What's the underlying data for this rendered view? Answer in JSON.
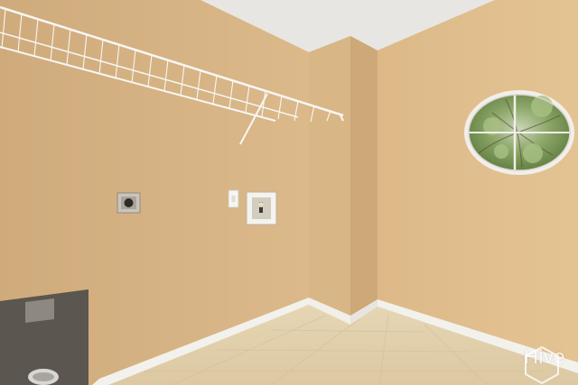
{
  "watermark": {
    "text": "Hive"
  },
  "colors": {
    "wall_left": "#d6b384",
    "wall_right": "#e0be8d",
    "ceiling": "#e9e8e4",
    "floor": "#e3d2b0",
    "baseboard": "#f4f2ee",
    "shelf": "#f7f7f5",
    "window_frame": "#f0eeea",
    "foliage": "#7f9a5a"
  },
  "icons": [
    "wire-shelf-icon",
    "round-window-icon",
    "dryer-outlet-icon",
    "light-switch-icon",
    "washer-box-icon",
    "dryer-vent-icon",
    "hive-logo-icon"
  ]
}
